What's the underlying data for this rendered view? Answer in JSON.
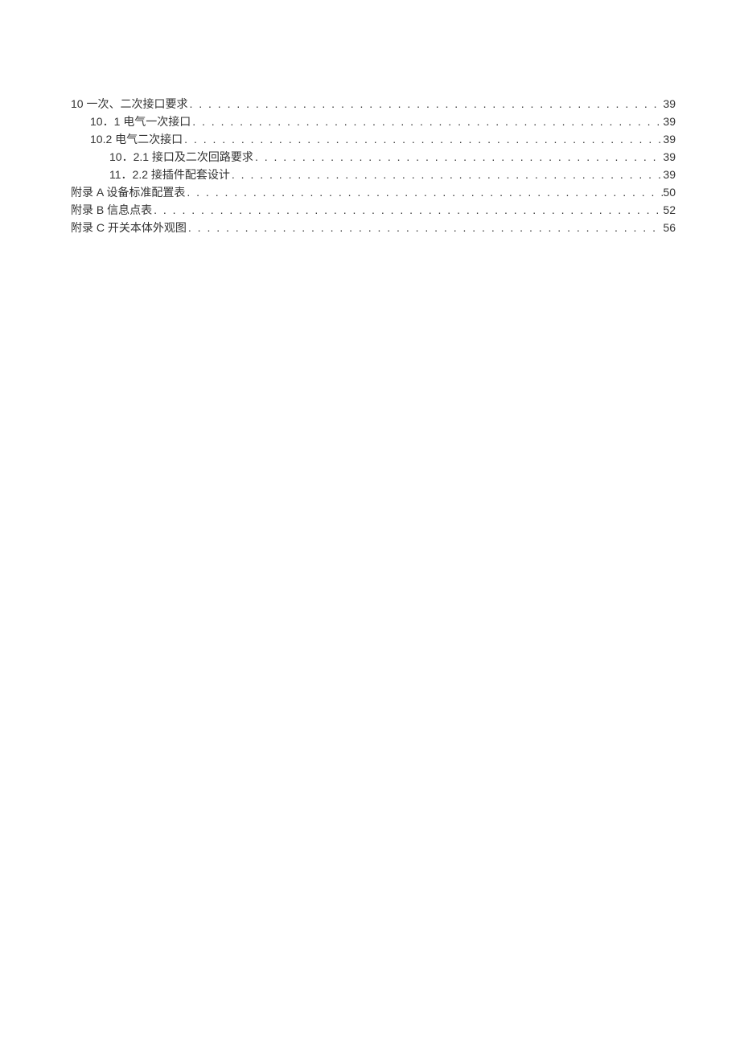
{
  "toc": {
    "entries": [
      {
        "level": 0,
        "title": "10 一次、二次接口要求",
        "page": "39"
      },
      {
        "level": 1,
        "title": "10．1 电气一次接口",
        "page": "39"
      },
      {
        "level": 1,
        "title": "10.2 电气二次接口",
        "page": "39"
      },
      {
        "level": 2,
        "title": "10．2.1 接口及二次回路要求",
        "page": "39"
      },
      {
        "level": 2,
        "title": "11．2.2 接插件配套设计",
        "page": "39"
      },
      {
        "level": 0,
        "title": "附录 A 设备标准配置表",
        "page": "50"
      },
      {
        "level": 0,
        "title": "附录 B 信息点表",
        "page": "52"
      },
      {
        "level": 0,
        "title": "附录 C 开关本体外观图",
        "page": "56"
      }
    ]
  }
}
